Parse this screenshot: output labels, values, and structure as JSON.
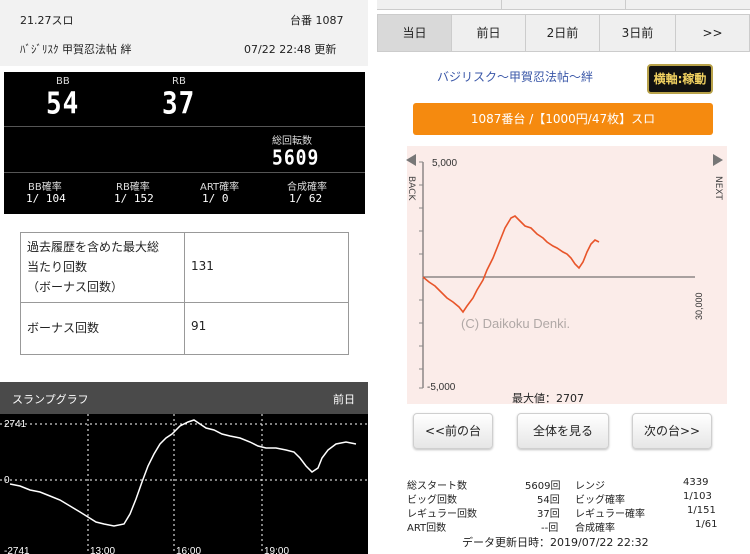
{
  "left": {
    "header": {
      "rate": "21.27スロ",
      "machine_no": "台番 1087",
      "machine_name": "ﾊﾞｼﾞﾘｽｸ 甲賀忍法帖 絆",
      "updated": "07/22 22:48 更新"
    },
    "counter": {
      "bb_label": "BB",
      "bb_value": "54",
      "rb_label": "RB",
      "rb_value": "37",
      "total_label": "総回転数",
      "total_value": "5609",
      "bb_rate_label": "BB確率",
      "bb_rate_value": "1/ 104",
      "rb_rate_label": "RB確率",
      "rb_rate_value": "1/ 152",
      "art_rate_label": "ART確率",
      "art_rate_value": "1/ 0",
      "combined_rate_label": "合成確率",
      "combined_rate_value": "1/ 62"
    },
    "history": {
      "max_label_line1": "過去履歴を含めた最大総",
      "max_label_line2": "当たり回数",
      "max_label_line3": "（ボーナス回数）",
      "max_value": "131",
      "bonus_label": "ボーナス回数",
      "bonus_value": "91"
    },
    "slump": {
      "title": "スランプグラフ",
      "prev_day": "前日",
      "y_top": "2741",
      "y_zero": "0",
      "y_bottom": "-2741",
      "x_labels": [
        "13:00",
        "16:00",
        "19:00"
      ]
    }
  },
  "right": {
    "tabs": [
      "当日",
      "前日",
      "2日前",
      "3日前",
      ">>"
    ],
    "active_tab": 0,
    "graph_title": "バジリスク～甲賀忍法帖～絆",
    "axis_button": "横軸:稼動",
    "machine_bar": "1087番台 /【1000円/47枚】スロ",
    "side_back": "BACK",
    "side_next": "NEXT",
    "y_top_label": "5,000",
    "y_bottom_label": "-5,000",
    "x_right_label": "30,000",
    "watermark": "(C) Daikoku Denki.",
    "max_value_label": "最大値：2707",
    "buttons": {
      "prev": "<<前の台",
      "all": "全体を見る",
      "next": "次の台>>"
    },
    "stats": {
      "start_label": "総スタート数",
      "start_value": "5609回",
      "range_label": "レンジ",
      "range_value": "4339",
      "big_label": "ビッグ回数",
      "big_value": "54回",
      "big_rate_label": "ビッグ確率",
      "big_rate_value": "1/103",
      "reg_label": "レギュラー回数",
      "reg_value": "37回",
      "reg_rate_label": "レギュラー確率",
      "reg_rate_value": "1/151",
      "art_label": "ART回数",
      "art_value": "--回",
      "comb_label": "合成確率",
      "comb_value": "1/61"
    },
    "updated": "データ更新日時：2019/07/22 22:32"
  },
  "colors": {
    "orange": "#f58a0f",
    "graph_bg": "#fbece9",
    "slump_line": "#ffffff",
    "graph_line": "#e8552a",
    "title_blue": "#3a57a8"
  }
}
